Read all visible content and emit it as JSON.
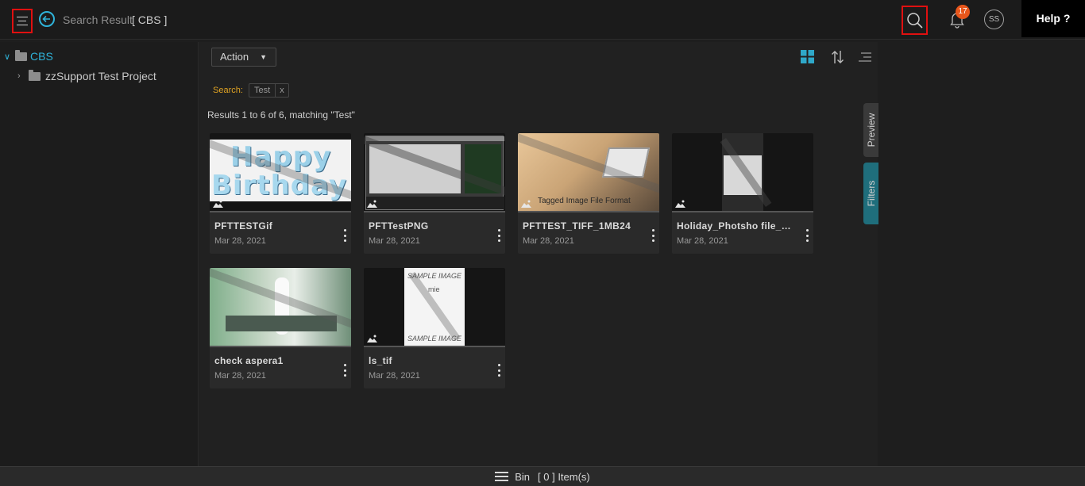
{
  "header": {
    "title": "Search Result",
    "scope": "[ CBS ]",
    "notification_count": "17",
    "avatar_initials": "SS",
    "help_label": "Help ?"
  },
  "tree": {
    "root": "CBS",
    "child": "zzSupport Test Project"
  },
  "toolbar": {
    "action_label": "Action"
  },
  "search": {
    "label": "Search:",
    "term": "Test",
    "clear": "x"
  },
  "results_text": "Results 1 to 6 of 6, matching \"Test\"",
  "cards": [
    {
      "title": "PFTTESTGif",
      "date": "Mar 28, 2021"
    },
    {
      "title": "PFTTestPNG",
      "date": "Mar 28, 2021"
    },
    {
      "title": "PFTTEST_TIFF_1MB24",
      "date": "Mar 28, 2021"
    },
    {
      "title": "Holiday_Photsho file_Te...",
      "date": "Mar 28, 2021"
    },
    {
      "title": "check aspera1",
      "date": "Mar 28, 2021"
    },
    {
      "title": "ls_tif",
      "date": "Mar 28, 2021"
    }
  ],
  "thumb_text": {
    "happy": "Happy",
    "birthday": "Birthday",
    "tagged": "Tagged Image File Format",
    "sample_top": "SAMPLE IMAGE",
    "sample_mid": "mie",
    "sample_bottom": "SAMPLE IMAGE"
  },
  "side_tabs": {
    "preview": "Preview",
    "filters": "Filters"
  },
  "bin": {
    "label": "Bin",
    "count": "[ 0 ] Item(s)"
  },
  "colors": {
    "accent": "#2fb3d9",
    "badge": "#e8561b",
    "search_label": "#e0a323",
    "filters_tab": "#1f6e7c"
  }
}
